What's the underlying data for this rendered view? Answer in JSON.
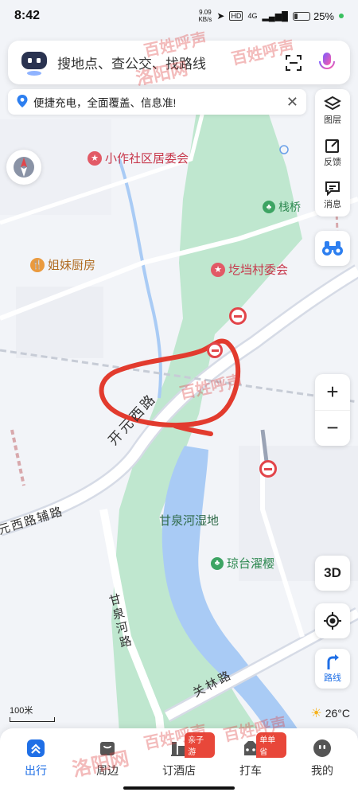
{
  "status_bar": {
    "time": "8:42",
    "net_speed_value": "9.09",
    "net_speed_unit": "KB/s",
    "network": "4G",
    "battery_percent": "25%",
    "battery_level": 0.25
  },
  "search": {
    "placeholder": "搜地点、查公交、找路线"
  },
  "notice": {
    "text": "便捷充电，全面覆盖、信息准!"
  },
  "tools": {
    "layers_label": "图层",
    "feedback_label": "反馈",
    "messages_label": "消息"
  },
  "map": {
    "labels": {
      "xiaozuo": "小作社区居委会",
      "zhanqiao": "栈桥",
      "jiemei": "姐妹厨房",
      "qidang": "圪垱村委会",
      "kaiyuan": "开元西路",
      "yuanxi_fu": "元西路辅路",
      "ganquan_wetland": "甘泉河湿地",
      "ganquan_river": "甘泉河路",
      "qiongtai": "琼台濯樱",
      "guanlin": "关林路"
    }
  },
  "controls": {
    "zoom_in": "+",
    "zoom_out": "−",
    "three_d": "3D",
    "route_label": "路线"
  },
  "scale": {
    "label": "100米"
  },
  "weather": {
    "temperature": "26°C"
  },
  "bottom_nav": {
    "items": [
      {
        "label": "出行",
        "active": true
      },
      {
        "label": "周边"
      },
      {
        "label": "订酒店",
        "badge": "亲子游"
      },
      {
        "label": "打车",
        "badge": "单单省"
      },
      {
        "label": "我的"
      }
    ]
  },
  "watermark": {
    "text": "百姓呼声",
    "source": "洛阳网"
  },
  "colors": {
    "accent": "#1f6fe6",
    "park": "#bfe7cf",
    "water": "#a9cbf5",
    "road": "#ffffff",
    "badge": "#e8473a",
    "annotation": "#e23b2e"
  }
}
